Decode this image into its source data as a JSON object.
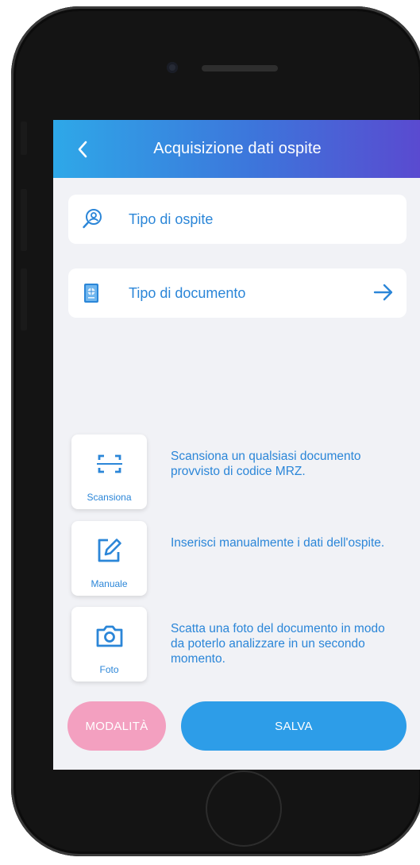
{
  "header": {
    "title": "Acquisizione dati ospite"
  },
  "fields": [
    {
      "label": "Tipo di ospite",
      "icon": "guest-search-icon"
    },
    {
      "label": "Tipo di documento",
      "icon": "passport-icon",
      "action_icon": "arrow-right-icon"
    }
  ],
  "modes": [
    {
      "label": "Scansiona",
      "icon": "scan-icon",
      "description": "Scansiona un qualsiasi documento provvisto di codice MRZ."
    },
    {
      "label": "Manuale",
      "icon": "edit-icon",
      "description": "Inserisci manualmente i dati dell'ospite."
    },
    {
      "label": "Foto",
      "icon": "camera-icon",
      "description": "Scatta una foto del documento in modo da poterlo analizzare in un secondo momento."
    }
  ],
  "buttons": {
    "modalita": "MODALITÀ",
    "salva": "SALVA"
  },
  "colors": {
    "accent": "#2b86d8",
    "header_start": "#2ea8e8",
    "header_end": "#5a4ad0",
    "salva_bg": "#2d9de8",
    "modalita_bg": "#f3a0c0",
    "screen_bg": "#f1f2f6"
  }
}
